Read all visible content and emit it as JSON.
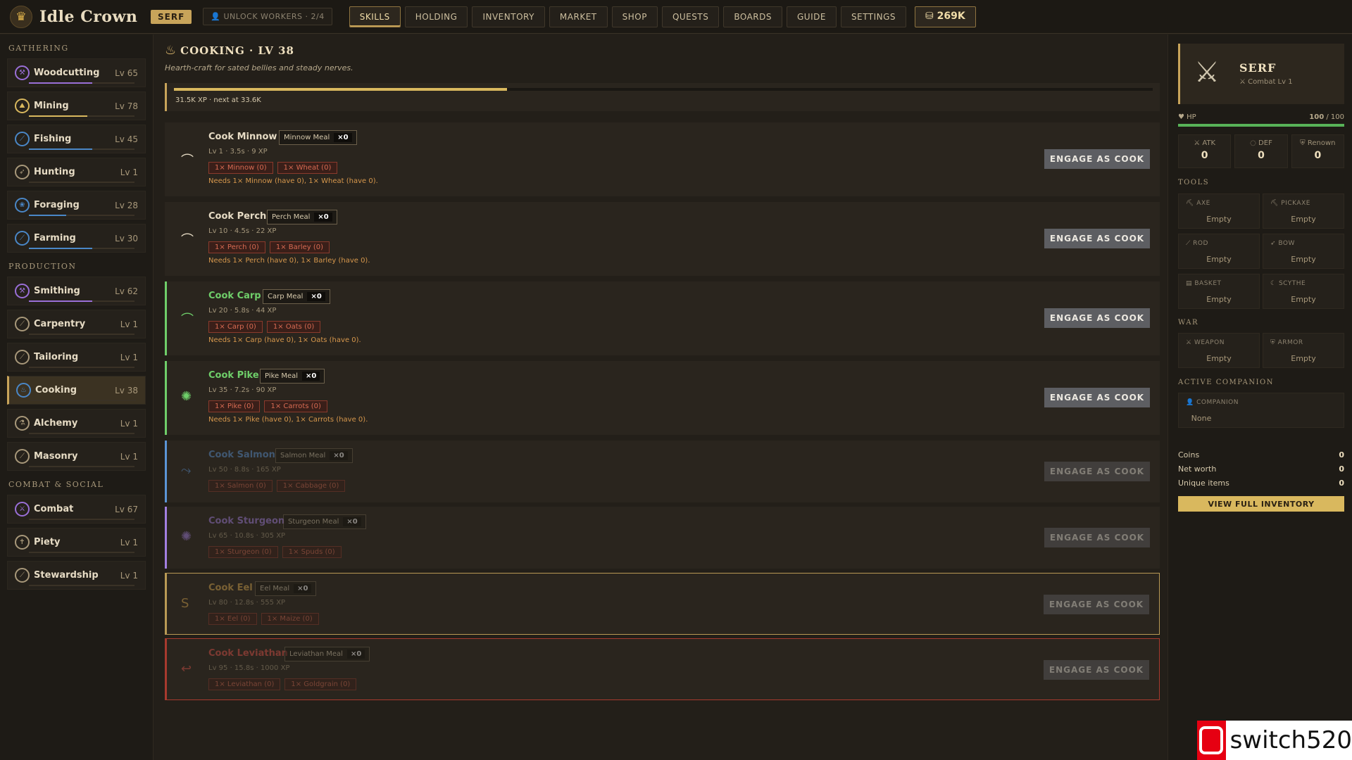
{
  "app": {
    "name": "Idle Crown",
    "rank": "SERF",
    "unlock_workers": "UNLOCK WORKERS · 2/4",
    "coins": "269K"
  },
  "nav": [
    "SKILLS",
    "HOLDING",
    "INVENTORY",
    "MARKET",
    "SHOP",
    "QUESTS",
    "BOARDS",
    "GUIDE",
    "SETTINGS"
  ],
  "sidebar": {
    "gathering_heading": "GATHERING",
    "gathering": [
      {
        "label": "Woodcutting",
        "level": "Lv 65",
        "progress": 0.6,
        "color": "#9a6fd8"
      },
      {
        "label": "Mining",
        "level": "Lv 78",
        "progress": 0.55,
        "color": "#d9b85e"
      },
      {
        "label": "Fishing",
        "level": "Lv 45",
        "progress": 0.6,
        "color": "#4a87c7"
      },
      {
        "label": "Hunting",
        "level": "Lv 1",
        "progress": 0,
        "color": "#a8987a"
      },
      {
        "label": "Foraging",
        "level": "Lv 28",
        "progress": 0.35,
        "color": "#4a87c7"
      },
      {
        "label": "Farming",
        "level": "Lv 30",
        "progress": 0.6,
        "color": "#4a87c7"
      }
    ],
    "production_heading": "PRODUCTION",
    "production": [
      {
        "label": "Smithing",
        "level": "Lv 62",
        "progress": 0.6,
        "color": "#9a6fd8"
      },
      {
        "label": "Carpentry",
        "level": "Lv 1",
        "progress": 0,
        "color": "#a8987a"
      },
      {
        "label": "Tailoring",
        "level": "Lv 1",
        "progress": 0,
        "color": "#a8987a"
      },
      {
        "label": "Cooking",
        "level": "Lv 38",
        "progress": 0,
        "color": "#4a87c7"
      },
      {
        "label": "Alchemy",
        "level": "Lv 1",
        "progress": 0,
        "color": "#a8987a"
      },
      {
        "label": "Masonry",
        "level": "Lv 1",
        "progress": 0,
        "color": "#a8987a"
      }
    ],
    "combat_heading": "COMBAT & SOCIAL",
    "combat": [
      {
        "label": "Combat",
        "level": "Lv 67",
        "progress": 0,
        "color": "#9a6fd8"
      },
      {
        "label": "Piety",
        "level": "Lv 1",
        "progress": 0,
        "color": "#a8987a"
      },
      {
        "label": "Stewardship",
        "level": "Lv 1",
        "progress": 0,
        "color": "#a8987a"
      }
    ]
  },
  "skill": {
    "title": "COOKING · LV 38",
    "subtitle": "Hearth-craft for sated bellies and steady nerves.",
    "xp_progress": 0.34,
    "xp_text": "31.5K XP · next at 33.6K"
  },
  "recipes": [
    {
      "name": "Cook Minnow",
      "output": "Minnow Meal",
      "count": "×0",
      "meta": "Lv 1 · 3.5s · 9 XP",
      "ingredients": [
        "1× Minnow (0)",
        "1× Wheat (0)"
      ],
      "need": "Needs 1× Minnow (have 0), 1× Wheat (have 0).",
      "color": "#e6dbc4"
    },
    {
      "name": "Cook Perch",
      "output": "Perch Meal",
      "count": "×0",
      "meta": "Lv 10 · 4.5s · 22 XP",
      "ingredients": [
        "1× Perch (0)",
        "1× Barley (0)"
      ],
      "need": "Needs 1× Perch (have 0), 1× Barley (have 0).",
      "color": "#e6dbc4"
    },
    {
      "name": "Cook Carp",
      "output": "Carp Meal",
      "count": "×0",
      "meta": "Lv 20 · 5.8s · 44 XP",
      "ingredients": [
        "1× Carp (0)",
        "1× Oats (0)"
      ],
      "need": "Needs 1× Carp (have 0), 1× Oats (have 0).",
      "color": "#6fcf6a"
    },
    {
      "name": "Cook Pike",
      "output": "Pike Meal",
      "count": "×0",
      "meta": "Lv 35 · 7.2s · 90 XP",
      "ingredients": [
        "1× Pike (0)",
        "1× Carrots (0)"
      ],
      "need": "Needs 1× Pike (have 0), 1× Carrots (have 0).",
      "color": "#6fcf6a"
    },
    {
      "name": "Cook Salmon",
      "output": "Salmon Meal",
      "count": "×0",
      "meta": "Lv 50 · 8.8s · 165 XP",
      "ingredients": [
        "1× Salmon (0)",
        "1× Cabbage (0)"
      ],
      "need": "",
      "color": "#5b95d6"
    },
    {
      "name": "Cook Sturgeon",
      "output": "Sturgeon Meal",
      "count": "×0",
      "meta": "Lv 65 · 10.8s · 305 XP",
      "ingredients": [
        "1× Sturgeon (0)",
        "1× Spuds (0)"
      ],
      "need": "",
      "color": "#a27fe0"
    },
    {
      "name": "Cook Eel",
      "output": "Eel Meal",
      "count": "×0",
      "meta": "Lv 80 · 12.8s · 555 XP",
      "ingredients": [
        "1× Eel (0)",
        "1× Maize (0)"
      ],
      "need": "",
      "color": "#d9a84e"
    },
    {
      "name": "Cook Leviathan",
      "output": "Leviathan Meal",
      "count": "×0",
      "meta": "Lv 95 · 15.8s · 1000 XP",
      "ingredients": [
        "1× Leviathan (0)",
        "1× Goldgrain (0)"
      ],
      "need": "",
      "color": "#e0534a"
    }
  ],
  "engage_label": "ENGAGE AS COOK",
  "character": {
    "name": "SERF",
    "combat": "⚔ Combat Lv 1",
    "hp_label": "♥ HP",
    "hp_value": "100",
    "hp_max": "/ 100",
    "hp_fraction": 1.0,
    "stats": [
      {
        "label": "⚔ ATK",
        "value": "0"
      },
      {
        "label": "◌ DEF",
        "value": "0"
      },
      {
        "label": "⛨ Renown",
        "value": "0"
      }
    ]
  },
  "tools_heading": "TOOLS",
  "tools": [
    {
      "label": "AXE",
      "value": "Empty"
    },
    {
      "label": "PICKAXE",
      "value": "Empty"
    },
    {
      "label": "ROD",
      "value": "Empty"
    },
    {
      "label": "BOW",
      "value": "Empty"
    },
    {
      "label": "BASKET",
      "value": "Empty"
    },
    {
      "label": "SCYTHE",
      "value": "Empty"
    }
  ],
  "war_heading": "WAR",
  "war": [
    {
      "label": "WEAPON",
      "value": "Empty"
    },
    {
      "label": "ARMOR",
      "value": "Empty"
    }
  ],
  "companion_heading": "ACTIVE COMPANION",
  "companion": {
    "label": "COMPANION",
    "value": "None"
  },
  "summary": [
    {
      "label": "Coins",
      "value": "0"
    },
    {
      "label": "Net worth",
      "value": "0"
    },
    {
      "label": "Unique items",
      "value": "0"
    }
  ],
  "view_inventory": "VIEW FULL INVENTORY",
  "watermark": "switch520"
}
